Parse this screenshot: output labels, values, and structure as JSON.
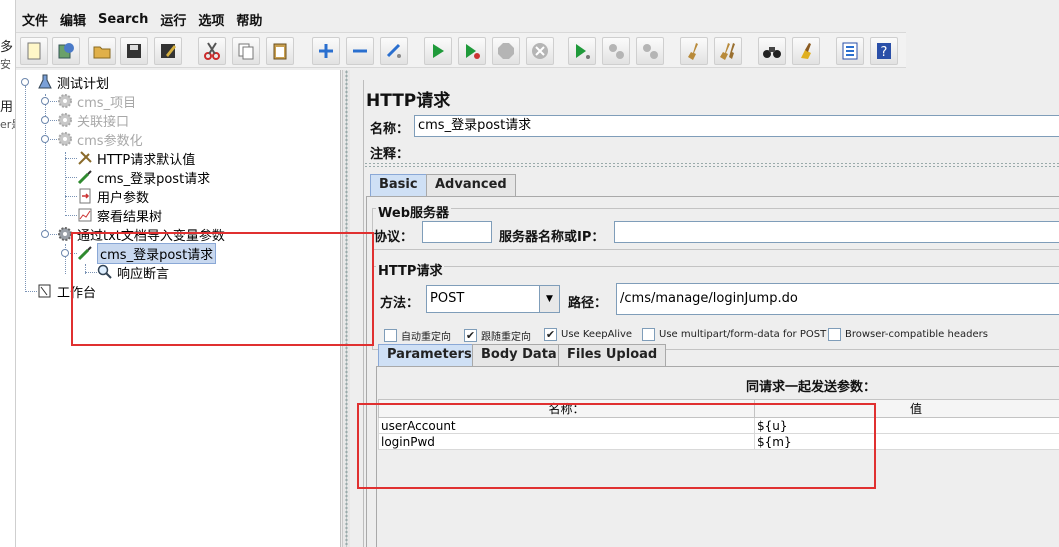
{
  "background": {
    "left_edge_fragments": [
      "多",
      "安",
      "用",
      "er是"
    ]
  },
  "menu": [
    "文件",
    "编辑",
    "Search",
    "运行",
    "选项",
    "帮助"
  ],
  "toolbar": {
    "buttons": [
      {
        "name": "new-icon",
        "color": "#fff7c8"
      },
      {
        "name": "templates-icon",
        "color": "#4c9a4c"
      },
      {
        "name": "open-icon",
        "color": "#d9a33a"
      },
      {
        "name": "save-icon",
        "color": "#333333"
      },
      {
        "name": "save-as-icon",
        "color": "#333333"
      },
      {
        "name": "cut-icon",
        "color": "#cc2b2b"
      },
      {
        "name": "copy-icon",
        "color": "#888888"
      },
      {
        "name": "paste-icon",
        "color": "#9a7b3a"
      },
      {
        "name": "expand-icon",
        "color": "#2a6fcf"
      },
      {
        "name": "collapse-icon",
        "color": "#2a6fcf"
      },
      {
        "name": "toggle-icon",
        "color": "#2a6fcf"
      },
      {
        "name": "start-icon",
        "color": "#1f9a3a"
      },
      {
        "name": "start-no-timers-icon",
        "color": "#1f9a3a"
      },
      {
        "name": "stop-icon",
        "color": "#b5b5b5"
      },
      {
        "name": "shutdown-icon",
        "color": "#b5b5b5"
      },
      {
        "name": "remote-start-icon",
        "color": "#1f9a3a"
      },
      {
        "name": "remote-stop-icon",
        "color": "#b5b5b5"
      },
      {
        "name": "remote-shutdown-icon",
        "color": "#b5b5b5"
      },
      {
        "name": "clear-icon",
        "color": "#b88a3a"
      },
      {
        "name": "clear-all-icon",
        "color": "#b88a3a"
      },
      {
        "name": "search-binoculars-icon",
        "color": "#333333"
      },
      {
        "name": "reset-search-icon",
        "color": "#e0b020"
      },
      {
        "name": "function-helper-icon",
        "color": "#2a6fcf"
      },
      {
        "name": "help-icon",
        "color": "#2a4fa8"
      }
    ]
  },
  "tree": {
    "items": [
      {
        "label": "测试计划",
        "icon": "test-plan-icon"
      },
      {
        "label": "cms_项目",
        "icon": "thread-group-gear-icon",
        "disabled": true
      },
      {
        "label": "关联接口",
        "icon": "thread-group-gear-icon",
        "disabled": true
      },
      {
        "label": "cms参数化",
        "icon": "thread-group-gear-icon",
        "disabled": true
      },
      {
        "label": "HTTP请求默认值",
        "icon": "config-wrench-icon"
      },
      {
        "label": "cms_登录post请求",
        "icon": "sampler-pipette-icon"
      },
      {
        "label": "用户参数",
        "icon": "preprocessor-icon"
      },
      {
        "label": "察看结果树",
        "icon": "listener-chart-icon"
      },
      {
        "label": "通过txt文档导入变量参数",
        "icon": "thread-group-gear-icon"
      },
      {
        "label": "cms_登录post请求",
        "icon": "sampler-pipette-icon",
        "selected": true
      },
      {
        "label": "响应断言",
        "icon": "assertion-magnifier-icon"
      },
      {
        "label": "工作台",
        "icon": "workbench-icon"
      }
    ]
  },
  "http": {
    "title": "HTTP请求",
    "name_label": "名称：",
    "name_value": "cms_登录post请求",
    "comment_label": "注释：",
    "tabs": [
      "Basic",
      "Advanced"
    ],
    "web_server_group": "Web服务器",
    "protocol_label": "协议：",
    "server_label": "服务器名称或IP：",
    "http_request_group": "HTTP请求",
    "method_label": "方法：",
    "method_value": "POST",
    "path_label": "路径：",
    "path_value": "/cms/manage/loginJump.do",
    "checkboxes": [
      {
        "label": "自动重定向",
        "checked": false
      },
      {
        "label": "跟随重定向",
        "checked": true
      },
      {
        "label": "Use KeepAlive",
        "checked": true
      },
      {
        "label": "Use multipart/form-data for POST",
        "checked": false
      },
      {
        "label": "Browser-compatible headers",
        "checked": false
      }
    ],
    "param_tabs": [
      "Parameters",
      "Body Data",
      "Files Upload"
    ],
    "params_caption": "同请求一起发送参数：",
    "columns": [
      "名称：",
      "值"
    ],
    "rows": [
      {
        "name": "userAccount",
        "value": "${u}"
      },
      {
        "name": "loginPwd",
        "value": "${m}"
      }
    ]
  },
  "annotation_color": "#e03030"
}
